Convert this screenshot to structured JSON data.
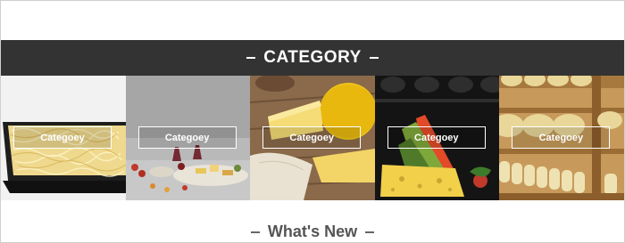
{
  "category_section": {
    "title": "CATEGORY"
  },
  "tiles": [
    {
      "label": "Categoey",
      "image": "shredded-cheese-tray"
    },
    {
      "label": "Categoey",
      "image": "cheese-platter-wine"
    },
    {
      "label": "Categoey",
      "image": "cheese-wheels-board"
    },
    {
      "label": "Categoey",
      "image": "colorful-cheese-wedges"
    },
    {
      "label": "Categoey",
      "image": "cheese-aging-shelves"
    }
  ],
  "whats_new": {
    "title": "What's New"
  }
}
